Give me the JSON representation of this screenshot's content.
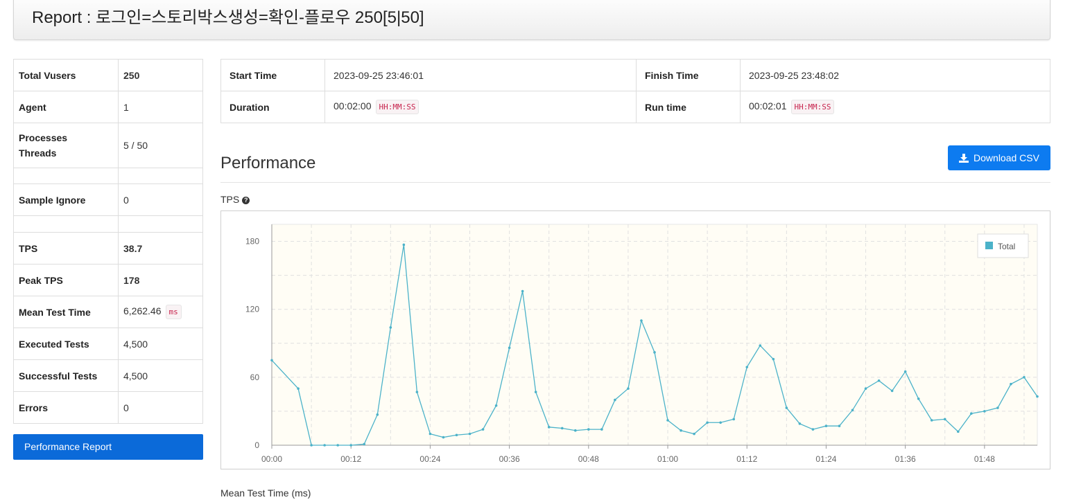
{
  "header": {
    "title": "Report : 로그인=스토리박스생성=확인-플로우 250[5|50]"
  },
  "summary": [
    {
      "label": "Total Vusers",
      "value": "250",
      "style": "blue"
    },
    {
      "label": "Agent",
      "value": "1"
    },
    {
      "label": "Processes Threads",
      "value": "5 / 50",
      "label_line1": "Processes",
      "label_line2": "Threads"
    },
    {
      "label": "",
      "value": ""
    },
    {
      "label": "Sample Ignore",
      "value": "0"
    },
    {
      "label": "",
      "value": ""
    },
    {
      "label": "TPS",
      "value": "38.7",
      "style": "blue"
    },
    {
      "label": "Peak TPS",
      "value": "178",
      "style": "blue"
    },
    {
      "label": "Mean Test Time",
      "value": "6,262.46",
      "unit": "ms"
    },
    {
      "label": "Executed Tests",
      "value": "4,500"
    },
    {
      "label": "Successful Tests",
      "value": "4,500"
    },
    {
      "label": "Errors",
      "value": "0"
    }
  ],
  "sidebar": {
    "performance_report_label": "Performance Report"
  },
  "timing": {
    "start_time_label": "Start Time",
    "start_time": "2023-09-25 23:46:01",
    "finish_time_label": "Finish Time",
    "finish_time": "2023-09-25 23:48:02",
    "duration_label": "Duration",
    "duration": "00:02:00",
    "duration_unit": "HH:MM:SS",
    "run_time_label": "Run time",
    "run_time": "00:02:01",
    "run_time_unit": "HH:MM:SS"
  },
  "performance": {
    "title": "Performance",
    "download_label": "Download CSV",
    "tps_label": "TPS",
    "mean_test_time_label": "Mean Test Time (ms)"
  },
  "colors": {
    "accent": "#0d7bf0",
    "series": "#4bb2c9",
    "plot_bg": "#fffdf5",
    "highlight": "#4f9fd1"
  },
  "chart_data": {
    "type": "line",
    "series": [
      {
        "name": "Total",
        "x": [
          0,
          4,
          6,
          8,
          10,
          12,
          14,
          16,
          18,
          20,
          22,
          24,
          26,
          28,
          30,
          32,
          34,
          36,
          38,
          40,
          42,
          44,
          46,
          48,
          50,
          52,
          54,
          56,
          58,
          60,
          62,
          64,
          66,
          68,
          70,
          72,
          74,
          76,
          78,
          80,
          82,
          84,
          86,
          88,
          90,
          92,
          94,
          96,
          98,
          100,
          102,
          104,
          106,
          108,
          110,
          112,
          114,
          116
        ],
        "values": [
          75,
          50,
          0,
          0,
          0,
          0,
          1,
          27,
          104,
          177,
          47,
          10,
          7,
          9,
          10,
          14,
          35,
          86,
          136,
          47,
          16,
          15,
          13,
          14,
          14,
          40,
          50,
          110,
          82,
          22,
          13,
          10,
          20,
          20,
          23,
          69,
          88,
          76,
          33,
          19,
          14,
          17,
          17,
          31,
          50,
          57,
          48,
          65,
          41,
          22,
          23,
          12,
          28,
          30,
          33,
          54,
          60,
          43
        ]
      }
    ],
    "x_tick_labels": [
      "00:00",
      "00:12",
      "00:24",
      "00:36",
      "00:48",
      "01:00",
      "01:12",
      "01:24",
      "01:36",
      "01:48"
    ],
    "y_tick_labels": [
      "0",
      "60",
      "120",
      "180"
    ],
    "xlim": [
      0,
      116
    ],
    "ylim": [
      0,
      195
    ],
    "legend": "top-right",
    "grid": true
  }
}
